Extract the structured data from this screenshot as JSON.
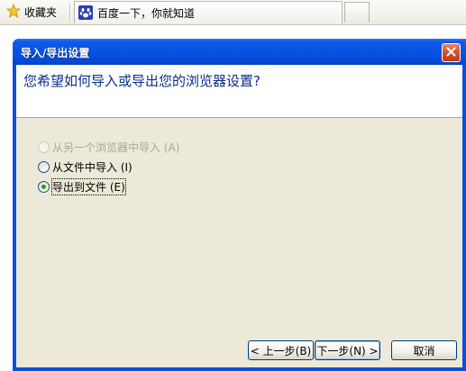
{
  "browser": {
    "favorites_label": "收藏夹",
    "tab_title": "百度一下，你就知道"
  },
  "dialog": {
    "title": "导入/导出设置",
    "question": "您希望如何导入或导出您的浏览器设置?",
    "options": [
      {
        "label": "从另一个浏览器中导入 (A)",
        "enabled": false,
        "checked": false
      },
      {
        "label": "从文件中导入 (I)",
        "enabled": true,
        "checked": false
      },
      {
        "label": "导出到文件 (E)",
        "enabled": true,
        "checked": true
      }
    ],
    "buttons": {
      "back": "< 上一步(B)",
      "next": "下一步(N) >",
      "cancel": "取消"
    }
  },
  "colors": {
    "titlebar": "#0653e3",
    "client_bg": "#ece9d8",
    "question_text": "#0a2e8a",
    "close_button": "#d34f2a"
  }
}
